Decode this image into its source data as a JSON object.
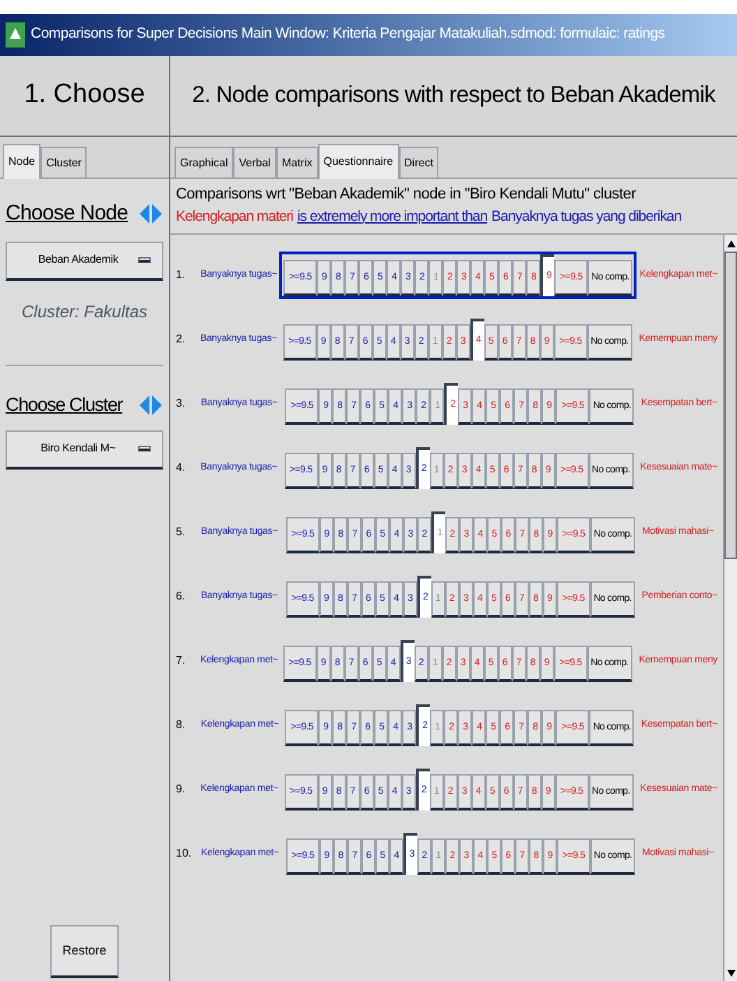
{
  "window": {
    "title": "Comparisons for Super Decisions Main Window: Kriteria Pengajar Matakuliah.sdmod: formulaic: ratings"
  },
  "left": {
    "heading": "1. Choose",
    "tabs": [
      {
        "label": "Node",
        "selected": true
      },
      {
        "label": "Cluster",
        "selected": false
      }
    ],
    "choose_node": {
      "label": "Choose Node",
      "value": "Beban Akademik",
      "cluster": "Cluster: Fakultas"
    },
    "choose_cluster": {
      "label": "Choose Cluster",
      "value": "Biro Kendali M~"
    },
    "restore": "Restore"
  },
  "right": {
    "heading": "2. Node comparisons with respect to Beban Akademik",
    "tabs": [
      {
        "label": "Graphical",
        "selected": false
      },
      {
        "label": "Verbal",
        "selected": false
      },
      {
        "label": "Matrix",
        "selected": false
      },
      {
        "label": "Questionnaire",
        "selected": true
      },
      {
        "label": "Direct",
        "selected": false
      }
    ],
    "context": "Comparisons wrt \"Beban Akademik\" node in \"Biro Kendali Mutu\" cluster",
    "verbal": {
      "subject": "Kelengkapan materi",
      "relation": "is extremely more important than",
      "object": "Banyaknya tugas yang diberikan"
    },
    "rows": [
      {
        "number": "1.",
        "left": "Banyaknya tugas~",
        "right": "Kelengkapan met~",
        "focused": true,
        "cells": [
          {
            "label": ">=9.5",
            "selected": false
          },
          {
            "label": "9",
            "selected": false
          },
          {
            "label": "8",
            "selected": false
          },
          {
            "label": "7",
            "selected": false
          },
          {
            "label": "6",
            "selected": false
          },
          {
            "label": "5",
            "selected": false
          },
          {
            "label": "4",
            "selected": false
          },
          {
            "label": "3",
            "selected": false
          },
          {
            "label": "2",
            "selected": false
          },
          {
            "label": "1",
            "selected": false
          },
          {
            "label": "2",
            "selected": false
          },
          {
            "label": "3",
            "selected": false
          },
          {
            "label": "4",
            "selected": false
          },
          {
            "label": "5",
            "selected": false
          },
          {
            "label": "6",
            "selected": false
          },
          {
            "label": "7",
            "selected": false
          },
          {
            "label": "8",
            "selected": false
          },
          {
            "label": "9",
            "selected": true
          },
          {
            "label": ">=9.5",
            "selected": false
          },
          {
            "label": "No comp.",
            "selected": false
          }
        ]
      },
      {
        "number": "2.",
        "left": "Banyaknya tugas~",
        "right": "Kemempuan meny",
        "focused": false,
        "cells": [
          {
            "label": ">=9.5",
            "selected": false
          },
          {
            "label": "9",
            "selected": false
          },
          {
            "label": "8",
            "selected": false
          },
          {
            "label": "7",
            "selected": false
          },
          {
            "label": "6",
            "selected": false
          },
          {
            "label": "5",
            "selected": false
          },
          {
            "label": "4",
            "selected": false
          },
          {
            "label": "3",
            "selected": false
          },
          {
            "label": "2",
            "selected": false
          },
          {
            "label": "1",
            "selected": false
          },
          {
            "label": "2",
            "selected": false
          },
          {
            "label": "3",
            "selected": false
          },
          {
            "label": "4",
            "selected": true
          },
          {
            "label": "5",
            "selected": false
          },
          {
            "label": "6",
            "selected": false
          },
          {
            "label": "7",
            "selected": false
          },
          {
            "label": "8",
            "selected": false
          },
          {
            "label": "9",
            "selected": false
          },
          {
            "label": ">=9.5",
            "selected": false
          },
          {
            "label": "No comp.",
            "selected": false
          }
        ]
      },
      {
        "number": "3.",
        "left": "Banyaknya tugas~",
        "right": "Kesempatan bert~",
        "focused": false,
        "cells": [
          {
            "label": ">=9.5",
            "selected": false
          },
          {
            "label": "9",
            "selected": false
          },
          {
            "label": "8",
            "selected": false
          },
          {
            "label": "7",
            "selected": false
          },
          {
            "label": "6",
            "selected": false
          },
          {
            "label": "5",
            "selected": false
          },
          {
            "label": "4",
            "selected": false
          },
          {
            "label": "3",
            "selected": false
          },
          {
            "label": "2",
            "selected": false
          },
          {
            "label": "1",
            "selected": false
          },
          {
            "label": "2",
            "selected": true
          },
          {
            "label": "3",
            "selected": false
          },
          {
            "label": "4",
            "selected": false
          },
          {
            "label": "5",
            "selected": false
          },
          {
            "label": "6",
            "selected": false
          },
          {
            "label": "7",
            "selected": false
          },
          {
            "label": "8",
            "selected": false
          },
          {
            "label": "9",
            "selected": false
          },
          {
            "label": ">=9.5",
            "selected": false
          },
          {
            "label": "No comp.",
            "selected": false
          }
        ]
      },
      {
        "number": "4.",
        "left": "Banyaknya tugas~",
        "right": "Kesesuaian mate~",
        "focused": false,
        "cells": [
          {
            "label": ">=9.5",
            "selected": false
          },
          {
            "label": "9",
            "selected": false
          },
          {
            "label": "8",
            "selected": false
          },
          {
            "label": "7",
            "selected": false
          },
          {
            "label": "6",
            "selected": false
          },
          {
            "label": "5",
            "selected": false
          },
          {
            "label": "4",
            "selected": false
          },
          {
            "label": "3",
            "selected": false
          },
          {
            "label": "2",
            "selected": true
          },
          {
            "label": "1",
            "selected": false
          },
          {
            "label": "2",
            "selected": false
          },
          {
            "label": "3",
            "selected": false
          },
          {
            "label": "4",
            "selected": false
          },
          {
            "label": "5",
            "selected": false
          },
          {
            "label": "6",
            "selected": false
          },
          {
            "label": "7",
            "selected": false
          },
          {
            "label": "8",
            "selected": false
          },
          {
            "label": "9",
            "selected": false
          },
          {
            "label": ">=9.5",
            "selected": false
          },
          {
            "label": "No comp.",
            "selected": false
          }
        ]
      },
      {
        "number": "5.",
        "left": "Banyaknya tugas~",
        "right": "Motivasi mahasi~",
        "focused": false,
        "cells": [
          {
            "label": ">=9.5",
            "selected": false
          },
          {
            "label": "9",
            "selected": false
          },
          {
            "label": "8",
            "selected": false
          },
          {
            "label": "7",
            "selected": false
          },
          {
            "label": "6",
            "selected": false
          },
          {
            "label": "5",
            "selected": false
          },
          {
            "label": "4",
            "selected": false
          },
          {
            "label": "3",
            "selected": false
          },
          {
            "label": "2",
            "selected": false
          },
          {
            "label": "1",
            "selected": true
          },
          {
            "label": "2",
            "selected": false
          },
          {
            "label": "3",
            "selected": false
          },
          {
            "label": "4",
            "selected": false
          },
          {
            "label": "5",
            "selected": false
          },
          {
            "label": "6",
            "selected": false
          },
          {
            "label": "7",
            "selected": false
          },
          {
            "label": "8",
            "selected": false
          },
          {
            "label": "9",
            "selected": false
          },
          {
            "label": ">=9.5",
            "selected": false
          },
          {
            "label": "No comp.",
            "selected": false
          }
        ]
      },
      {
        "number": "6.",
        "left": "Banyaknya tugas~",
        "right": "Pemberian conto~",
        "focused": false,
        "cells": [
          {
            "label": ">=9.5",
            "selected": false
          },
          {
            "label": "9",
            "selected": false
          },
          {
            "label": "8",
            "selected": false
          },
          {
            "label": "7",
            "selected": false
          },
          {
            "label": "6",
            "selected": false
          },
          {
            "label": "5",
            "selected": false
          },
          {
            "label": "4",
            "selected": false
          },
          {
            "label": "3",
            "selected": false
          },
          {
            "label": "2",
            "selected": true
          },
          {
            "label": "1",
            "selected": false
          },
          {
            "label": "2",
            "selected": false
          },
          {
            "label": "3",
            "selected": false
          },
          {
            "label": "4",
            "selected": false
          },
          {
            "label": "5",
            "selected": false
          },
          {
            "label": "6",
            "selected": false
          },
          {
            "label": "7",
            "selected": false
          },
          {
            "label": "8",
            "selected": false
          },
          {
            "label": "9",
            "selected": false
          },
          {
            "label": ">=9.5",
            "selected": false
          },
          {
            "label": "No comp.",
            "selected": false
          }
        ]
      },
      {
        "number": "7.",
        "left": "Kelengkapan met~",
        "right": "Kemempuan meny",
        "focused": false,
        "cells": [
          {
            "label": ">=9.5",
            "selected": false
          },
          {
            "label": "9",
            "selected": false
          },
          {
            "label": "8",
            "selected": false
          },
          {
            "label": "7",
            "selected": false
          },
          {
            "label": "6",
            "selected": false
          },
          {
            "label": "5",
            "selected": false
          },
          {
            "label": "4",
            "selected": false
          },
          {
            "label": "3",
            "selected": true
          },
          {
            "label": "2",
            "selected": false
          },
          {
            "label": "1",
            "selected": false
          },
          {
            "label": "2",
            "selected": false
          },
          {
            "label": "3",
            "selected": false
          },
          {
            "label": "4",
            "selected": false
          },
          {
            "label": "5",
            "selected": false
          },
          {
            "label": "6",
            "selected": false
          },
          {
            "label": "7",
            "selected": false
          },
          {
            "label": "8",
            "selected": false
          },
          {
            "label": "9",
            "selected": false
          },
          {
            "label": ">=9.5",
            "selected": false
          },
          {
            "label": "No comp.",
            "selected": false
          }
        ]
      },
      {
        "number": "8.",
        "left": "Kelengkapan met~",
        "right": "Kesempatan bert~",
        "focused": false,
        "cells": [
          {
            "label": ">=9.5",
            "selected": false
          },
          {
            "label": "9",
            "selected": false
          },
          {
            "label": "8",
            "selected": false
          },
          {
            "label": "7",
            "selected": false
          },
          {
            "label": "6",
            "selected": false
          },
          {
            "label": "5",
            "selected": false
          },
          {
            "label": "4",
            "selected": false
          },
          {
            "label": "3",
            "selected": false
          },
          {
            "label": "2",
            "selected": true
          },
          {
            "label": "1",
            "selected": false
          },
          {
            "label": "2",
            "selected": false
          },
          {
            "label": "3",
            "selected": false
          },
          {
            "label": "4",
            "selected": false
          },
          {
            "label": "5",
            "selected": false
          },
          {
            "label": "6",
            "selected": false
          },
          {
            "label": "7",
            "selected": false
          },
          {
            "label": "8",
            "selected": false
          },
          {
            "label": "9",
            "selected": false
          },
          {
            "label": ">=9.5",
            "selected": false
          },
          {
            "label": "No comp.",
            "selected": false
          }
        ]
      },
      {
        "number": "9.",
        "left": "Kelengkapan met~",
        "right": "Kesesuaian mate~",
        "focused": false,
        "cells": [
          {
            "label": ">=9.5",
            "selected": false
          },
          {
            "label": "9",
            "selected": false
          },
          {
            "label": "8",
            "selected": false
          },
          {
            "label": "7",
            "selected": false
          },
          {
            "label": "6",
            "selected": false
          },
          {
            "label": "5",
            "selected": false
          },
          {
            "label": "4",
            "selected": false
          },
          {
            "label": "3",
            "selected": false
          },
          {
            "label": "2",
            "selected": true
          },
          {
            "label": "1",
            "selected": false
          },
          {
            "label": "2",
            "selected": false
          },
          {
            "label": "3",
            "selected": false
          },
          {
            "label": "4",
            "selected": false
          },
          {
            "label": "5",
            "selected": false
          },
          {
            "label": "6",
            "selected": false
          },
          {
            "label": "7",
            "selected": false
          },
          {
            "label": "8",
            "selected": false
          },
          {
            "label": "9",
            "selected": false
          },
          {
            "label": ">=9.5",
            "selected": false
          },
          {
            "label": "No comp.",
            "selected": false
          }
        ]
      },
      {
        "number": "10.",
        "left": "Kelengkapan met~",
        "right": "Motivasi mahasi~",
        "focused": false,
        "cells": [
          {
            "label": ">=9.5",
            "selected": false
          },
          {
            "label": "9",
            "selected": false
          },
          {
            "label": "8",
            "selected": false
          },
          {
            "label": "7",
            "selected": false
          },
          {
            "label": "6",
            "selected": false
          },
          {
            "label": "5",
            "selected": false
          },
          {
            "label": "4",
            "selected": false
          },
          {
            "label": "3",
            "selected": true
          },
          {
            "label": "2",
            "selected": false
          },
          {
            "label": "1",
            "selected": false
          },
          {
            "label": "2",
            "selected": false
          },
          {
            "label": "3",
            "selected": false
          },
          {
            "label": "4",
            "selected": false
          },
          {
            "label": "5",
            "selected": false
          },
          {
            "label": "6",
            "selected": false
          },
          {
            "label": "7",
            "selected": false
          },
          {
            "label": "8",
            "selected": false
          },
          {
            "label": "9",
            "selected": false
          },
          {
            "label": ">=9.5",
            "selected": false
          },
          {
            "label": "No comp.",
            "selected": false
          }
        ]
      }
    ]
  }
}
